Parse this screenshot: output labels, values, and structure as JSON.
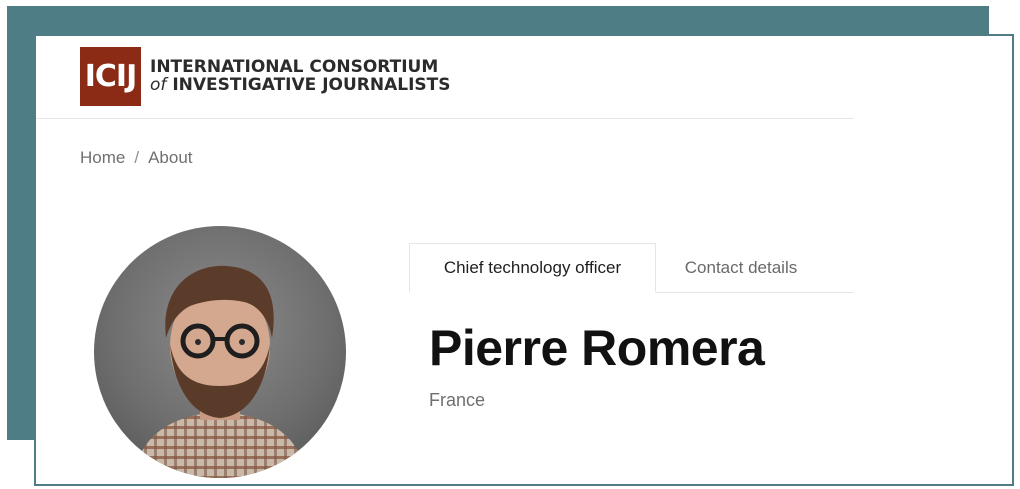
{
  "logo": {
    "mark": "ICIJ",
    "line1": "INTERNATIONAL CONSORTIUM",
    "line2_of": "of",
    "line2_rest": "INVESTIGATIVE JOURNALISTS",
    "color": "#8b2a15"
  },
  "breadcrumb": {
    "home": "Home",
    "separator": "/",
    "current": "About"
  },
  "tabs": [
    {
      "label": "Chief technology officer",
      "active": true
    },
    {
      "label": "Contact details",
      "active": false
    }
  ],
  "profile": {
    "name": "Pierre Romera",
    "country": "France"
  },
  "colors": {
    "frame": "#4f7d86",
    "background": "#ffffff"
  }
}
